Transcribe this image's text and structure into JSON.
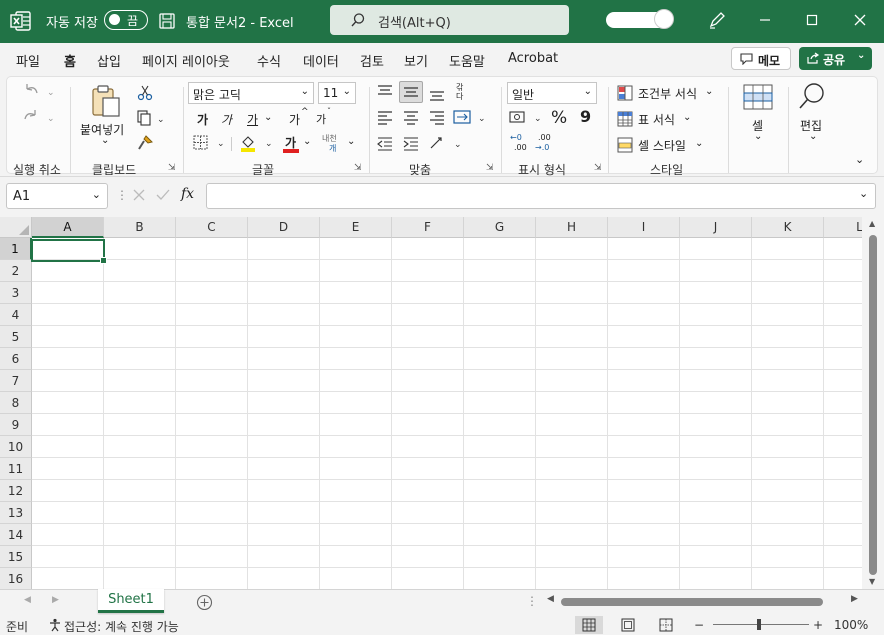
{
  "titlebar": {
    "autosave_label": "자동 저장",
    "autosave_state": "끔",
    "doc_title": "통합 문서2  -  Excel",
    "search_placeholder": "검색(Alt+Q)"
  },
  "menu": {
    "tabs": [
      "파일",
      "홈",
      "삽입",
      "페이지 레이아웃",
      "수식",
      "데이터",
      "검토",
      "보기",
      "도움말",
      "Acrobat"
    ],
    "active_tab": "홈",
    "memo_label": "메모",
    "share_label": "공유"
  },
  "ribbon": {
    "groups": {
      "undo": "실행 취소",
      "clipboard": "클립보드",
      "font": "글꼴",
      "alignment": "맞춤",
      "number": "표시 형식",
      "styles": "스타일"
    },
    "paste_label": "붙여넣기",
    "font_name": "맑은 고딕",
    "font_size": "11",
    "bold": "가",
    "italic": "가",
    "underline": "가",
    "grow_font": "가",
    "shrink_font": "가",
    "font_color_glyph": "가",
    "phonetic_top": "내천",
    "phonetic_bottom": "개",
    "wrap_top": "갂",
    "wrap_bottom": "다",
    "number_format": "일반",
    "percent": "%",
    "comma": "9",
    "inc_decimal_top": "←0",
    "inc_decimal_bottom": ".00",
    "dec_decimal_top": ".00",
    "dec_decimal_bottom": "→.0",
    "conditional_format": "조건부 서식",
    "table_format": "표 서식",
    "cell_styles": "셀 스타일",
    "cells_label": "셀",
    "editing_label": "편집"
  },
  "formula_bar": {
    "name_box": "A1",
    "fx": "fx",
    "value": ""
  },
  "sheet": {
    "columns": [
      "A",
      "B",
      "C",
      "D",
      "E",
      "F",
      "G",
      "H",
      "I",
      "J",
      "K",
      "L"
    ],
    "rows": [
      "1",
      "2",
      "3",
      "4",
      "5",
      "6",
      "7",
      "8",
      "9",
      "10",
      "11",
      "12",
      "13",
      "14",
      "15",
      "16"
    ],
    "active_cell": "A1",
    "tabs": [
      "Sheet1"
    ]
  },
  "status": {
    "ready": "준비",
    "accessibility": "접근성: 계속 진행 가능",
    "zoom": "100%",
    "zoom_minus": "−",
    "zoom_plus": "+"
  },
  "colors": {
    "accent": "#217346",
    "title_bar": "#217346"
  }
}
